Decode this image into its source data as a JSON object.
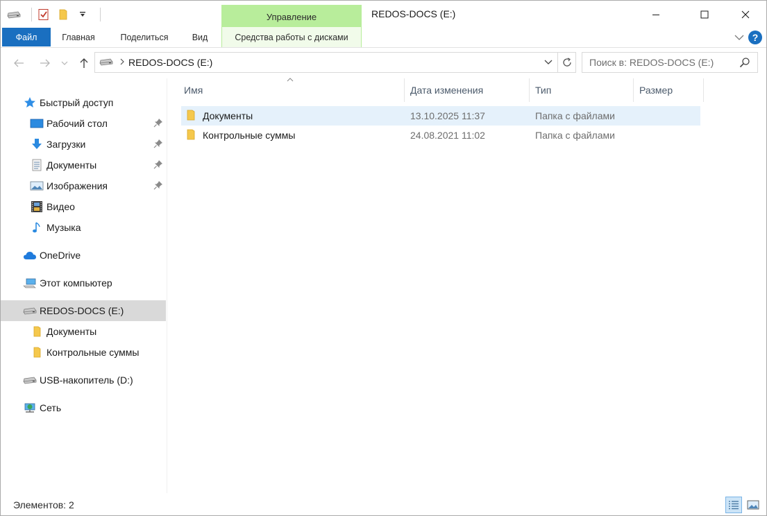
{
  "window": {
    "title": "REDOS-DOCS (E:)",
    "context_group_label": "Управление"
  },
  "ribbon": {
    "tabs": [
      {
        "label": "Файл"
      },
      {
        "label": "Главная"
      },
      {
        "label": "Поделиться"
      },
      {
        "label": "Вид"
      },
      {
        "label": "Средства работы с дисками"
      }
    ],
    "help_label": "?"
  },
  "address": {
    "path": "REDOS-DOCS (E:)",
    "search_placeholder": "Поиск в: REDOS-DOCS (E:)"
  },
  "navpane": {
    "items": [
      {
        "label": "Быстрый доступ",
        "icon": "star-icon"
      },
      {
        "label": "Рабочий стол",
        "icon": "desktop-icon",
        "pinned": true
      },
      {
        "label": "Загрузки",
        "icon": "download-icon",
        "pinned": true
      },
      {
        "label": "Документы",
        "icon": "documents-icon",
        "pinned": true
      },
      {
        "label": "Изображения",
        "icon": "pictures-icon",
        "pinned": true
      },
      {
        "label": "Видео",
        "icon": "video-icon"
      },
      {
        "label": "Музыка",
        "icon": "music-icon"
      },
      {
        "label": "OneDrive",
        "icon": "cloud-icon"
      },
      {
        "label": "Этот компьютер",
        "icon": "computer-icon"
      },
      {
        "label": "REDOS-DOCS (E:)",
        "icon": "drive-icon",
        "selected": true
      },
      {
        "label": "Документы",
        "icon": "folder-icon"
      },
      {
        "label": "Контрольные суммы",
        "icon": "folder-icon"
      },
      {
        "label": "USB-накопитель (D:)",
        "icon": "drive-icon"
      },
      {
        "label": "Сеть",
        "icon": "network-icon"
      }
    ]
  },
  "filelist": {
    "columns": [
      "Имя",
      "Дата изменения",
      "Тип",
      "Размер"
    ],
    "rows": [
      {
        "name": "Документы",
        "modified": "13.10.2025 11:37",
        "type": "Папка с файлами",
        "size": "",
        "selected": true
      },
      {
        "name": "Контрольные суммы",
        "modified": "24.08.2021 11:02",
        "type": "Папка с файлами",
        "size": ""
      }
    ]
  },
  "status": {
    "items_count": "Элементов: 2"
  },
  "colors": {
    "file_tab": "#1a6fc0",
    "context_tab": "#b8ed9b",
    "selection": "#e5f1fb",
    "nav_selection": "#d9d9d9"
  }
}
